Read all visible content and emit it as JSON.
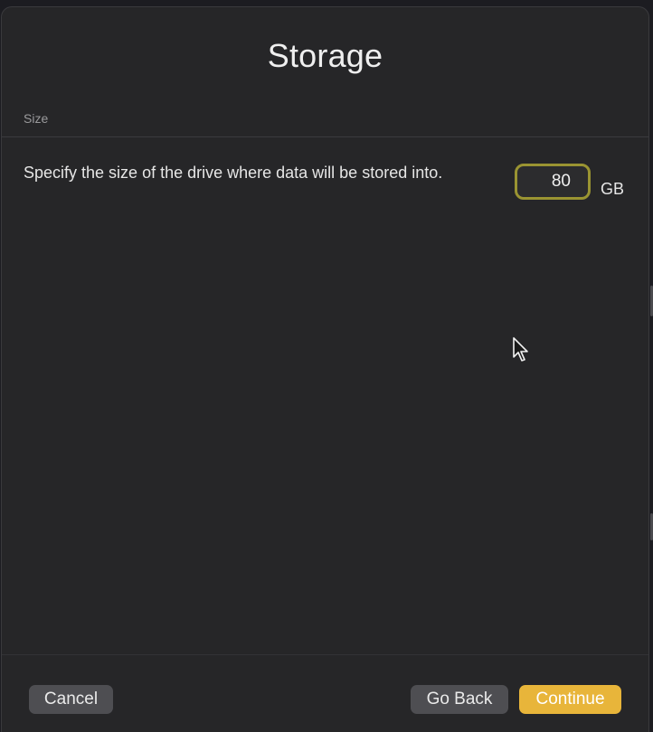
{
  "dialog": {
    "title": "Storage",
    "section_label": "Size",
    "description": "Specify the size of the drive where data will be stored into.",
    "size_field": {
      "value": "80",
      "unit": "GB"
    }
  },
  "footer": {
    "cancel_label": "Cancel",
    "back_label": "Go Back",
    "continue_label": "Continue"
  },
  "colors": {
    "accent": "#e8b53a",
    "focus_ring": "#9a9432",
    "dialog_background": "#262628"
  },
  "icons": {
    "cursor": "mouse-pointer-icon"
  }
}
